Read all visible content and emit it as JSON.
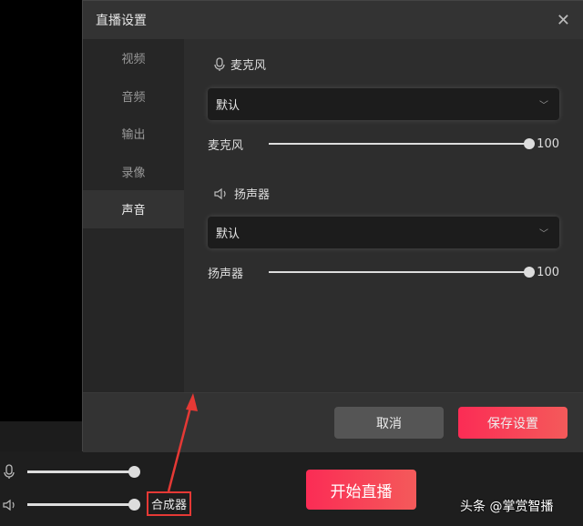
{
  "dialog": {
    "title": "直播设置",
    "close_icon": "close-icon"
  },
  "sidebar": {
    "items": [
      {
        "label": "视频"
      },
      {
        "label": "音频"
      },
      {
        "label": "输出"
      },
      {
        "label": "录像"
      },
      {
        "label": "声音",
        "active": true
      }
    ]
  },
  "microphone": {
    "section_label": "麦克风",
    "device": "默认",
    "slider_label": "麦克风",
    "value": "100"
  },
  "speaker": {
    "section_label": "扬声器",
    "device": "默认",
    "slider_label": "扬声器",
    "value": "100"
  },
  "footer": {
    "cancel": "取消",
    "save": "保存设置"
  },
  "bottom": {
    "start": "开始直播",
    "mixer": "合成器",
    "mic_level": 100,
    "speaker_level": 100
  },
  "watermark": "头条 @掌赏智播",
  "colors": {
    "accent": "#fb2c55",
    "annotation": "#e53935"
  }
}
